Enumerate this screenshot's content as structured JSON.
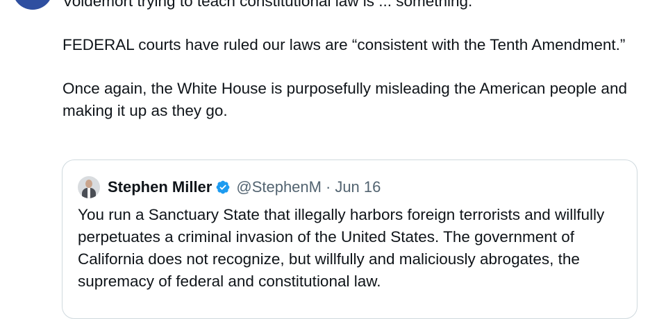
{
  "tweet": {
    "paragraphs": [
      "Voldemort trying to teach constitutional law is ... something.",
      "FEDERAL courts have ruled our laws are “consistent with the Tenth Amendment.”",
      "Once again, the White House is purposefully misleading the American people and making it up as they go."
    ]
  },
  "quote": {
    "author_name": "Stephen Miller",
    "handle": "@StephenM",
    "separator": "·",
    "date": "Jun 16",
    "verified": true,
    "text": "You run a Sanctuary State that illegally harbors foreign terrorists and willfully perpetuates a criminal invasion of the United States. The government of California does not recognize, but willfully and maliciously abrogates, the supremacy of federal and constitutional law."
  },
  "colors": {
    "text": "#0f1419",
    "secondary_text": "#536471",
    "border": "#cfd9de",
    "verified_badge": "#1d9bf0",
    "author_avatar": "#2f4fa0"
  },
  "icons": {
    "verified": "verified-badge-icon"
  }
}
